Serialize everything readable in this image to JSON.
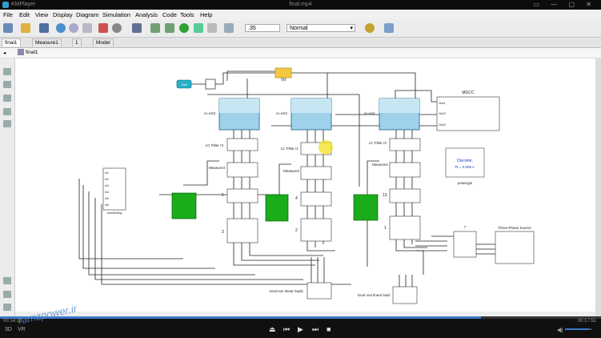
{
  "window": {
    "app_name": "KMPlayer",
    "file_name": "final.mp4"
  },
  "menu": [
    "File",
    "Edit",
    "View",
    "Display",
    "Diagram",
    "Simulation",
    "Analysis",
    "Code",
    "Tools",
    "Help"
  ],
  "toolbar": {
    "stop_time": ".35",
    "sim_mode": "Normal"
  },
  "tabs": [
    "final1",
    "Measure1",
    "1",
    "Model"
  ],
  "breadcrumb": "final1",
  "diagram": {
    "vdc_label": "Vdc",
    "vd_label": "Vd",
    "vsi": [
      "vc-vsi3",
      "vc-vsi2",
      "vc-vsi1"
    ],
    "lc_filters": [
      "LC Filter r3",
      "LC Filter r1",
      "LC Filter r2"
    ],
    "measures": [
      "Measure3",
      "Measure2",
      "Measure1"
    ],
    "mgcc": {
      "title": "MGCC",
      "ports": [
        "Out1",
        "Out2",
        "Out3"
      ]
    },
    "powergui": {
      "line1": "Discrete,",
      "line2": "Ts = 0.005 s.",
      "label": "powergui"
    },
    "monitoring": {
      "label": "monitoring",
      "ports": [
        "m1",
        "m2",
        "m3",
        "m4",
        "m5",
        "m6"
      ]
    },
    "line_block_numbers": [
      "5",
      "3",
      "4",
      "2",
      "13",
      "1",
      "7"
    ],
    "three_phase_source": "Three-Phase Source",
    "loads": [
      "local non linear load1",
      "local non linear load"
    ]
  },
  "player": {
    "time_current": "00:14:18",
    "time_total": "00:17:51",
    "progress_fraction": 0.8,
    "watermark": "ramzpower.ir"
  }
}
